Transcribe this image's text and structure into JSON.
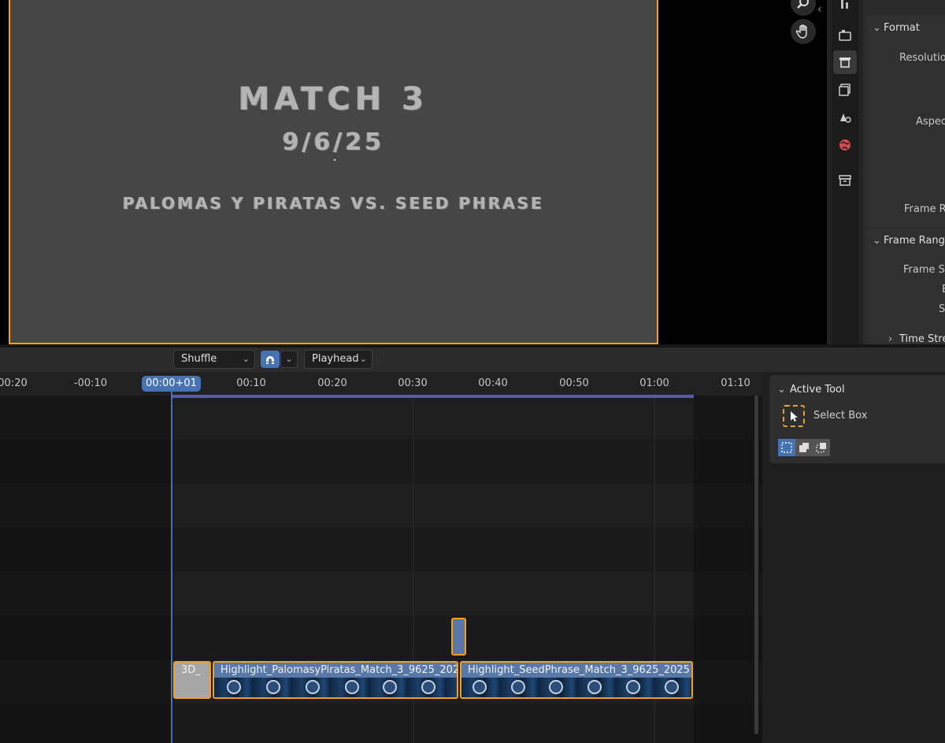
{
  "preview": {
    "title": "MATCH 3",
    "date": "9/6/25",
    "teams": "PALOMAS Y PIRATAS  VS.  SEED PHRASE"
  },
  "properties": {
    "format_header": "Format",
    "resolution_label": "Resolutio",
    "aspect_label": "Aspec",
    "frame_rate_label": "Frame R",
    "frame_range_header": "Frame Rang",
    "frame_start_label": "Frame S",
    "end_label": "E",
    "step_label": "S",
    "time_stretch_header": "Time Stre"
  },
  "header": {
    "overlap_mode": "Shuffle",
    "snap_to": "Playhead"
  },
  "timeline": {
    "ticks": [
      "00:20",
      "-00:10",
      "00:10",
      "00:20",
      "00:30",
      "00:40",
      "00:50",
      "01:00",
      "01:10"
    ],
    "current_time": "00:00+01",
    "strips": {
      "text_strip": "3D_",
      "clip_1": "Highlight_PalomasyPiratas_Match_3_9625_202",
      "clip_2": "Highlight_SeedPhrase_Match_3_9625_2025"
    }
  },
  "tool_panel": {
    "header": "Active Tool",
    "tool_name": "Select Box"
  },
  "colors": {
    "accent": "#4772b3",
    "selection": "#f2a024",
    "strip_movie": "#5879a8",
    "range": "#5a5aa8"
  },
  "icons": [
    "zoom-icon",
    "hand-icon",
    "tool-icon",
    "render-icon",
    "output-icon",
    "view-layer-icon",
    "scene-icon",
    "world-icon",
    "collection-icon",
    "magnet-icon",
    "select-box-icon"
  ]
}
